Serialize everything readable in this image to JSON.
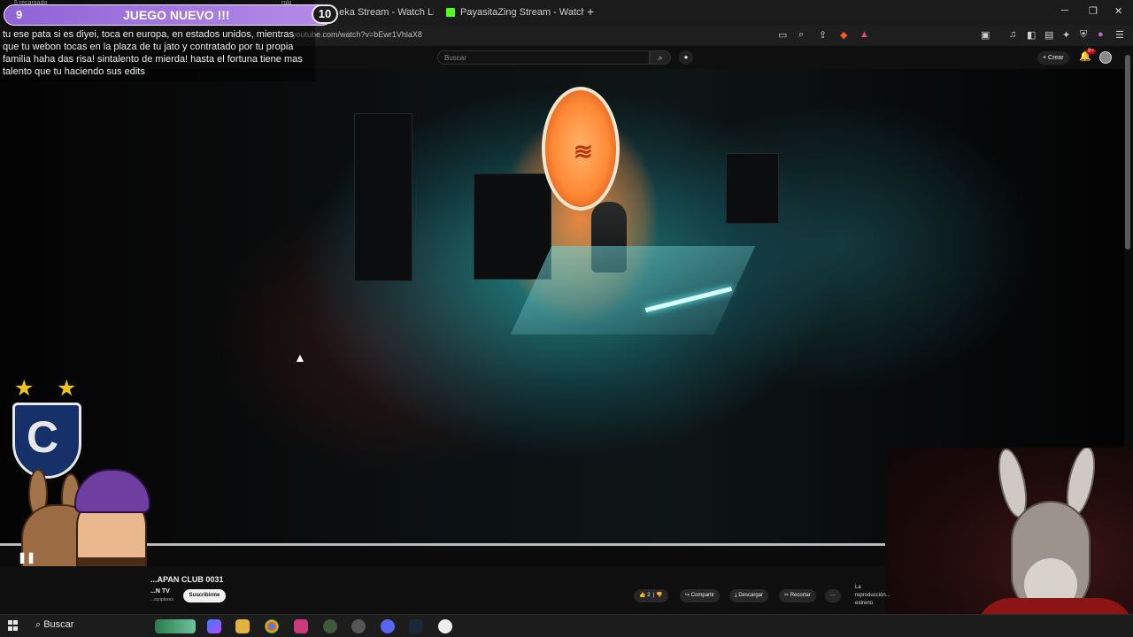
{
  "browser": {
    "tabs": [
      {
        "label": "...eka Stream - Watch Live on",
        "icon": "kick-icon"
      },
      {
        "label": "PayasitaZing Stream - Watch Live on",
        "icon": "kick-icon"
      }
    ],
    "url": "youtube.com/watch?v=bEwr1VhlaX8"
  },
  "youtube": {
    "search_placeholder": "Buscar",
    "create_label": "+ Crear",
    "notification_count": "9+"
  },
  "overlay": {
    "chat_meta": "5 recargado",
    "chat_meta_user": "rpki",
    "pill_number": "9",
    "pill_label": "JUEGO NUEVO !!!",
    "pill_badge": "10",
    "chat_message": "tu ese pata si es diyei, toca en europa, en estados unidos, mientras que tu webon tocas en la plaza de tu jato y contratado por tu propia familia haha das risa! sintalento de mierda! hasta el fortuna tiene mas talento que tu haciendo sus edits"
  },
  "video": {
    "title": "...APAN CLUB 0031",
    "channel": "...N TV",
    "subscribers": "...scriptores",
    "subscribe_label": "Suscribirme",
    "likes": "2",
    "share_label": "Compartir",
    "download_label": "Descargar",
    "clip_label": "Recortar",
    "more_label": "···",
    "premiere_note": "La reproducción... estreno."
  },
  "taskbar": {
    "search_label": "Buscar"
  },
  "colors": {
    "pill": "#a77bdf",
    "accent_red": "#cc0000",
    "tab_icon": "#53fc18"
  }
}
